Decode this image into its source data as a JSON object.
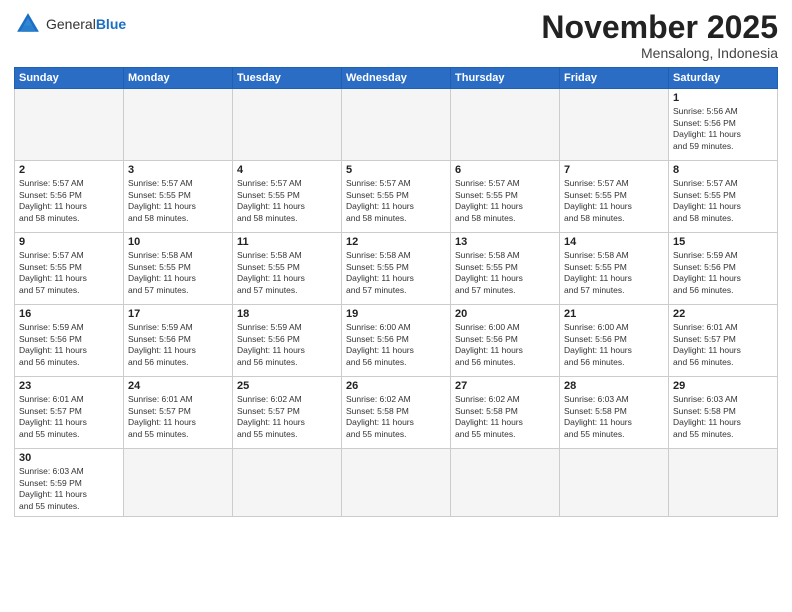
{
  "header": {
    "logo_general": "General",
    "logo_blue": "Blue",
    "month_title": "November 2025",
    "location": "Mensalong, Indonesia"
  },
  "weekdays": [
    "Sunday",
    "Monday",
    "Tuesday",
    "Wednesday",
    "Thursday",
    "Friday",
    "Saturday"
  ],
  "weeks": [
    [
      {
        "day": "",
        "info": ""
      },
      {
        "day": "",
        "info": ""
      },
      {
        "day": "",
        "info": ""
      },
      {
        "day": "",
        "info": ""
      },
      {
        "day": "",
        "info": ""
      },
      {
        "day": "",
        "info": ""
      },
      {
        "day": "1",
        "info": "Sunrise: 5:56 AM\nSunset: 5:56 PM\nDaylight: 11 hours\nand 59 minutes."
      }
    ],
    [
      {
        "day": "2",
        "info": "Sunrise: 5:57 AM\nSunset: 5:56 PM\nDaylight: 11 hours\nand 58 minutes."
      },
      {
        "day": "3",
        "info": "Sunrise: 5:57 AM\nSunset: 5:55 PM\nDaylight: 11 hours\nand 58 minutes."
      },
      {
        "day": "4",
        "info": "Sunrise: 5:57 AM\nSunset: 5:55 PM\nDaylight: 11 hours\nand 58 minutes."
      },
      {
        "day": "5",
        "info": "Sunrise: 5:57 AM\nSunset: 5:55 PM\nDaylight: 11 hours\nand 58 minutes."
      },
      {
        "day": "6",
        "info": "Sunrise: 5:57 AM\nSunset: 5:55 PM\nDaylight: 11 hours\nand 58 minutes."
      },
      {
        "day": "7",
        "info": "Sunrise: 5:57 AM\nSunset: 5:55 PM\nDaylight: 11 hours\nand 58 minutes."
      },
      {
        "day": "8",
        "info": "Sunrise: 5:57 AM\nSunset: 5:55 PM\nDaylight: 11 hours\nand 58 minutes."
      }
    ],
    [
      {
        "day": "9",
        "info": "Sunrise: 5:57 AM\nSunset: 5:55 PM\nDaylight: 11 hours\nand 57 minutes."
      },
      {
        "day": "10",
        "info": "Sunrise: 5:58 AM\nSunset: 5:55 PM\nDaylight: 11 hours\nand 57 minutes."
      },
      {
        "day": "11",
        "info": "Sunrise: 5:58 AM\nSunset: 5:55 PM\nDaylight: 11 hours\nand 57 minutes."
      },
      {
        "day": "12",
        "info": "Sunrise: 5:58 AM\nSunset: 5:55 PM\nDaylight: 11 hours\nand 57 minutes."
      },
      {
        "day": "13",
        "info": "Sunrise: 5:58 AM\nSunset: 5:55 PM\nDaylight: 11 hours\nand 57 minutes."
      },
      {
        "day": "14",
        "info": "Sunrise: 5:58 AM\nSunset: 5:55 PM\nDaylight: 11 hours\nand 57 minutes."
      },
      {
        "day": "15",
        "info": "Sunrise: 5:59 AM\nSunset: 5:56 PM\nDaylight: 11 hours\nand 56 minutes."
      }
    ],
    [
      {
        "day": "16",
        "info": "Sunrise: 5:59 AM\nSunset: 5:56 PM\nDaylight: 11 hours\nand 56 minutes."
      },
      {
        "day": "17",
        "info": "Sunrise: 5:59 AM\nSunset: 5:56 PM\nDaylight: 11 hours\nand 56 minutes."
      },
      {
        "day": "18",
        "info": "Sunrise: 5:59 AM\nSunset: 5:56 PM\nDaylight: 11 hours\nand 56 minutes."
      },
      {
        "day": "19",
        "info": "Sunrise: 6:00 AM\nSunset: 5:56 PM\nDaylight: 11 hours\nand 56 minutes."
      },
      {
        "day": "20",
        "info": "Sunrise: 6:00 AM\nSunset: 5:56 PM\nDaylight: 11 hours\nand 56 minutes."
      },
      {
        "day": "21",
        "info": "Sunrise: 6:00 AM\nSunset: 5:56 PM\nDaylight: 11 hours\nand 56 minutes."
      },
      {
        "day": "22",
        "info": "Sunrise: 6:01 AM\nSunset: 5:57 PM\nDaylight: 11 hours\nand 56 minutes."
      }
    ],
    [
      {
        "day": "23",
        "info": "Sunrise: 6:01 AM\nSunset: 5:57 PM\nDaylight: 11 hours\nand 55 minutes."
      },
      {
        "day": "24",
        "info": "Sunrise: 6:01 AM\nSunset: 5:57 PM\nDaylight: 11 hours\nand 55 minutes."
      },
      {
        "day": "25",
        "info": "Sunrise: 6:02 AM\nSunset: 5:57 PM\nDaylight: 11 hours\nand 55 minutes."
      },
      {
        "day": "26",
        "info": "Sunrise: 6:02 AM\nSunset: 5:58 PM\nDaylight: 11 hours\nand 55 minutes."
      },
      {
        "day": "27",
        "info": "Sunrise: 6:02 AM\nSunset: 5:58 PM\nDaylight: 11 hours\nand 55 minutes."
      },
      {
        "day": "28",
        "info": "Sunrise: 6:03 AM\nSunset: 5:58 PM\nDaylight: 11 hours\nand 55 minutes."
      },
      {
        "day": "29",
        "info": "Sunrise: 6:03 AM\nSunset: 5:58 PM\nDaylight: 11 hours\nand 55 minutes."
      }
    ],
    [
      {
        "day": "30",
        "info": "Sunrise: 6:03 AM\nSunset: 5:59 PM\nDaylight: 11 hours\nand 55 minutes."
      },
      {
        "day": "",
        "info": ""
      },
      {
        "day": "",
        "info": ""
      },
      {
        "day": "",
        "info": ""
      },
      {
        "day": "",
        "info": ""
      },
      {
        "day": "",
        "info": ""
      },
      {
        "day": "",
        "info": ""
      }
    ]
  ]
}
